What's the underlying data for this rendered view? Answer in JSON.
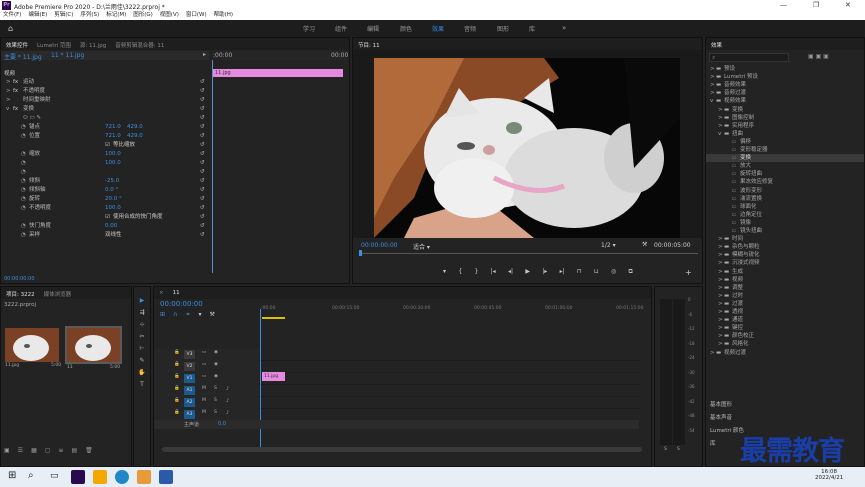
{
  "app": {
    "title": "Adobe Premiere Pro 2020 - D:\\兰雨佳\\3222.prproj *",
    "logo": "Pr"
  },
  "menu": [
    "文件(F)",
    "编辑(E)",
    "剪辑(C)",
    "序列(S)",
    "标记(M)",
    "图形(G)",
    "视图(V)",
    "窗口(W)",
    "帮助(H)"
  ],
  "workspaces": [
    "学习",
    "组件",
    "编辑",
    "颜色",
    "效果",
    "音频",
    "图形",
    "库"
  ],
  "ws_active": "效果",
  "effect_controls": {
    "tabs": [
      "效果控件",
      "Lumetri 范围",
      "源: 11.jpg",
      "音频剪辑混合器: 11"
    ],
    "master": "主要 * 11.jpg",
    "clip": "11 * 11.jpg",
    "time_start": ":00:00",
    "time_end": "00:00",
    "clip_label": "11.jpg",
    "section_video": "视频",
    "rows": [
      {
        "name": "运动",
        "fx": true,
        "expand": ">"
      },
      {
        "name": "不透明度",
        "fx": true,
        "expand": ">"
      },
      {
        "name": "时间重映射",
        "fx": false,
        "expand": ">"
      },
      {
        "name": "变换",
        "fx": true,
        "expand": "v"
      },
      {
        "name": "",
        "shapes": true
      },
      {
        "name": "锚点",
        "v1": "721.0",
        "v2": "429.0"
      },
      {
        "name": "位置",
        "v1": "721.0",
        "v2": "429.0"
      },
      {
        "name": "",
        "check": "等比缩放"
      },
      {
        "name": "缩放",
        "v1": "100.0"
      },
      {
        "name": "",
        "v1": "100.0"
      },
      {
        "name": "",
        "v1": ""
      },
      {
        "name": "倾斜",
        "v1": "-25.0"
      },
      {
        "name": "倾斜轴",
        "v1": "0.0 °"
      },
      {
        "name": "旋转",
        "v1": "20.0 °"
      },
      {
        "name": "不透明度",
        "v1": "100.0"
      },
      {
        "name": "",
        "check": "使用合成的快门角度"
      },
      {
        "name": "快门角度",
        "v1": "0.00"
      },
      {
        "name": "采样",
        "v1": "双线性"
      }
    ],
    "timecode": "00:00:00:00"
  },
  "program": {
    "title": "节目: 11",
    "timecode": "00:00:00:00",
    "fit": "适合",
    "quality": "1/2",
    "duration": "00:00:05:00"
  },
  "effects": {
    "title": "效果",
    "items": [
      {
        "t": "预设",
        "d": 0
      },
      {
        "t": "Lumetri 预设",
        "d": 0
      },
      {
        "t": "音频效果",
        "d": 0
      },
      {
        "t": "音频过渡",
        "d": 0
      },
      {
        "t": "视频效果",
        "d": 0,
        "open": true
      },
      {
        "t": "变换",
        "d": 1
      },
      {
        "t": "图像控制",
        "d": 1
      },
      {
        "t": "实用程序",
        "d": 1
      },
      {
        "t": "扭曲",
        "d": 1,
        "open": true
      },
      {
        "t": "偏移",
        "d": 2
      },
      {
        "t": "变形稳定器",
        "d": 2
      },
      {
        "t": "变换",
        "d": 2,
        "sel": true
      },
      {
        "t": "放大",
        "d": 2
      },
      {
        "t": "旋转扭曲",
        "d": 2
      },
      {
        "t": "果冻效应修复",
        "d": 2
      },
      {
        "t": "波形变形",
        "d": 2
      },
      {
        "t": "湍流置换",
        "d": 2
      },
      {
        "t": "球面化",
        "d": 2
      },
      {
        "t": "边角定位",
        "d": 2
      },
      {
        "t": "镜像",
        "d": 2
      },
      {
        "t": "镜头扭曲",
        "d": 2
      },
      {
        "t": "时间",
        "d": 1
      },
      {
        "t": "杂色与颗粒",
        "d": 1
      },
      {
        "t": "模糊与锐化",
        "d": 1
      },
      {
        "t": "沉浸式视频",
        "d": 1
      },
      {
        "t": "生成",
        "d": 1
      },
      {
        "t": "视频",
        "d": 1
      },
      {
        "t": "调整",
        "d": 1
      },
      {
        "t": "过时",
        "d": 1
      },
      {
        "t": "过渡",
        "d": 1
      },
      {
        "t": "透视",
        "d": 1
      },
      {
        "t": "通道",
        "d": 1
      },
      {
        "t": "键控",
        "d": 1
      },
      {
        "t": "颜色校正",
        "d": 1
      },
      {
        "t": "风格化",
        "d": 1
      },
      {
        "t": "视频过渡",
        "d": 0
      }
    ],
    "footer": [
      "基本图形",
      "基本声音",
      "Lumetri 颜色",
      "库"
    ]
  },
  "project": {
    "tabs": [
      "项目: 3222",
      "媒体浏览器"
    ],
    "file": "3222.prproj",
    "items": [
      {
        "name": "11.jpg",
        "dur": "5:00"
      },
      {
        "name": "11",
        "dur": "5:00"
      }
    ]
  },
  "timeline": {
    "tab": "11",
    "timecode": "00:00:00:00",
    "ruler": [
      ":00:00",
      "00:00:15:00",
      "00:00:30:00",
      "00:00:45:00",
      "00:01:00:00",
      "00:01:15:00"
    ],
    "tracks": [
      "V3",
      "V2",
      "V1",
      "A1",
      "A2",
      "A3"
    ],
    "master": "主声道",
    "master_val": "0.0",
    "clip": "11.jpg"
  },
  "meter": {
    "labels": [
      "0",
      "-6",
      "-12",
      "-18",
      "-24",
      "-30",
      "-36",
      "-42",
      "-48",
      "-54"
    ],
    "bottom": [
      "S",
      "S"
    ]
  },
  "watermark": "最需教育",
  "taskbar": {
    "time": "16:08",
    "date": "2022/4/21"
  }
}
